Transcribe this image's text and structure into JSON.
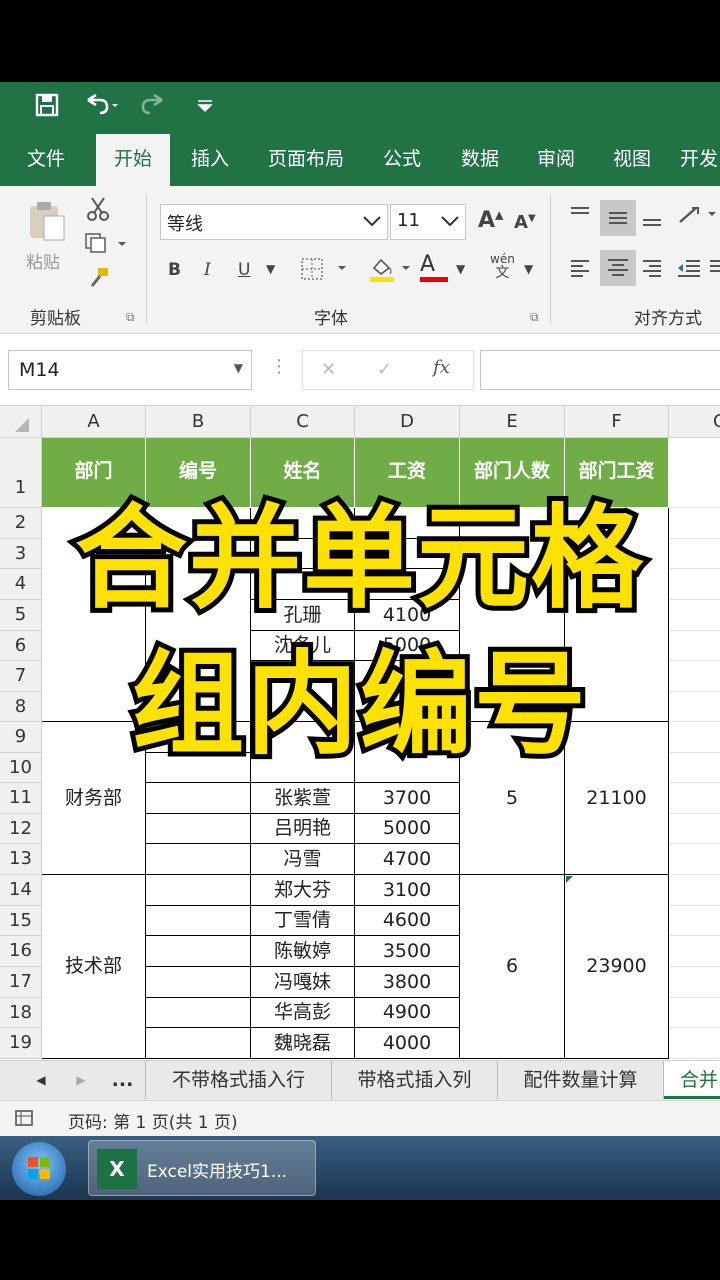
{
  "qat": {
    "save_icon": "save-icon",
    "undo_icon": "undo-icon",
    "redo_icon": "redo-icon",
    "customize_icon": "customize-qat-icon"
  },
  "tabs": [
    "文件",
    "开始",
    "插入",
    "页面布局",
    "公式",
    "数据",
    "审阅",
    "视图",
    "开发"
  ],
  "active_tab": "开始",
  "ribbon": {
    "paste_label": "粘贴",
    "clipboard_label": "剪贴板",
    "font_name": "等线",
    "font_size": "11",
    "grow_font": "A",
    "shrink_font": "A",
    "bold": "B",
    "italic": "I",
    "underline": "U",
    "font_color": "A",
    "phonetic_top": "wén",
    "phonetic_bottom": "文",
    "font_group_label": "字体",
    "align_group_label": "对齐方式"
  },
  "formula_bar": {
    "name_box": "M14",
    "cancel": "✕",
    "enter": "✓",
    "fx": "fx",
    "formula": ""
  },
  "columns": [
    "A",
    "B",
    "C",
    "D",
    "E",
    "F",
    "G"
  ],
  "rows": [
    "1",
    "2",
    "3",
    "4",
    "5",
    "6",
    "7",
    "8",
    "9",
    "10",
    "11",
    "12",
    "13",
    "14",
    "15",
    "16",
    "17",
    "18",
    "19"
  ],
  "table": {
    "headers": [
      "部门",
      "编号",
      "姓名",
      "工资",
      "部门人数",
      "部门工资"
    ],
    "rows_partial": [
      {
        "name": "",
        "salary": ""
      },
      {
        "name": "",
        "salary": ""
      },
      {
        "name": "",
        "salary": ""
      },
      {
        "name": "孔珊",
        "salary": "4100"
      },
      {
        "name": "沈冬儿",
        "salary": "5000"
      }
    ],
    "finance": {
      "dept": "财务部",
      "count": "5",
      "total": "21100",
      "rows": [
        {
          "name": "张紫萱",
          "salary": "3700"
        },
        {
          "name": "吕明艳",
          "salary": "5000"
        },
        {
          "name": "冯雪",
          "salary": "4700"
        }
      ]
    },
    "tech": {
      "dept": "技术部",
      "count": "6",
      "total": "23900",
      "rows": [
        {
          "name": "郑大芬",
          "salary": "3100"
        },
        {
          "name": "丁雪倩",
          "salary": "4600"
        },
        {
          "name": "陈敏婷",
          "salary": "3500"
        },
        {
          "name": "冯嘎妹",
          "salary": "3800"
        },
        {
          "name": "华高彭",
          "salary": "4900"
        },
        {
          "name": "魏晓磊",
          "salary": "4000"
        }
      ]
    }
  },
  "overlay": {
    "line1": "合并单元格",
    "line2": "组内编号"
  },
  "sheet_tabs": {
    "nav_prev": "◀",
    "nav_next": "▶",
    "more": "...",
    "tabs": [
      "不带格式插入行",
      "带格式插入列",
      "配件数量计算",
      "合并"
    ],
    "active": "合并"
  },
  "status": {
    "page": "页码: 第 1 页(共 1 页)"
  },
  "taskbar": {
    "app_label": "Excel实用技巧1..."
  },
  "colors": {
    "excel_green": "#217346",
    "header_fill": "#70ad47",
    "overlay_text": "#ffe100"
  }
}
